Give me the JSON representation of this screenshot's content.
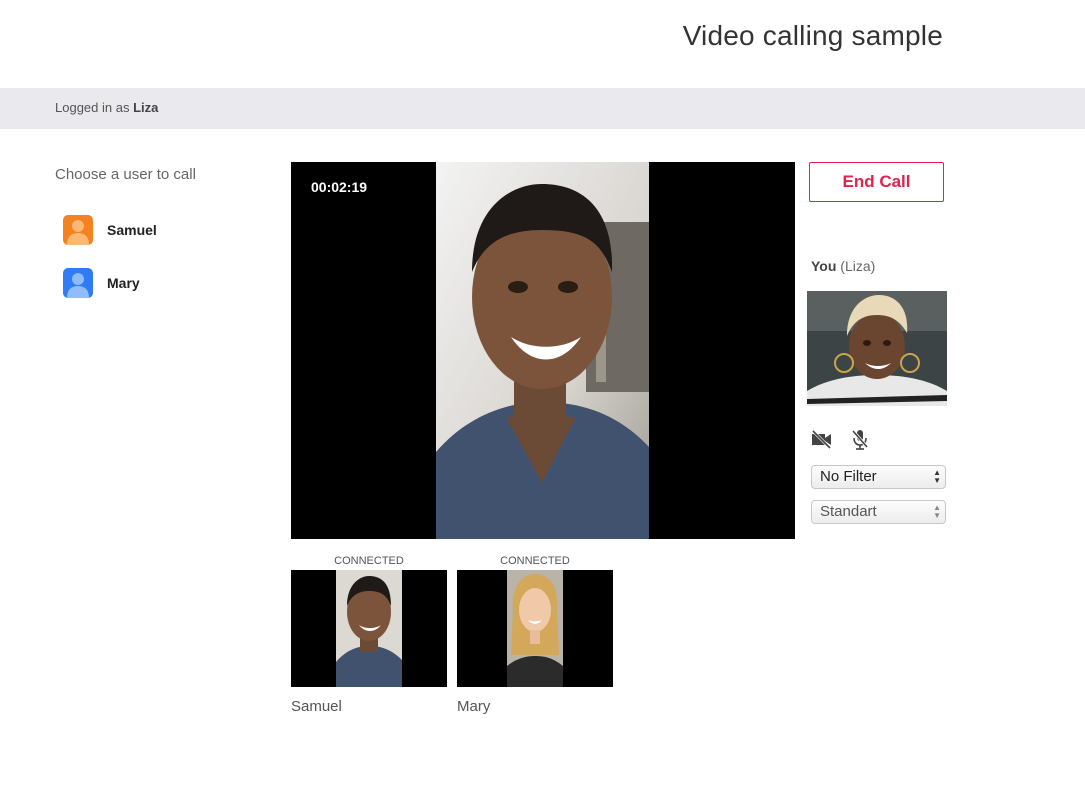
{
  "header": {
    "title": "Video calling sample"
  },
  "status_bar": {
    "prefix": "Logged in as",
    "username": "Liza"
  },
  "sidebar": {
    "heading": "Choose a user to call",
    "users": [
      {
        "name": "Samuel",
        "avatar_color": "#f58220"
      },
      {
        "name": "Mary",
        "avatar_color": "#2f7cf6"
      }
    ]
  },
  "call": {
    "timer": "00:02:19",
    "end_call_label": "End Call",
    "accent_color": "#e0224d"
  },
  "self_view": {
    "you_label": "You",
    "name_label": "(Liza)"
  },
  "controls": {
    "camera_icon": "camera-off-icon",
    "mic_icon": "mic-off-icon",
    "filter_selected": "No Filter",
    "quality_selected": "Standart"
  },
  "participants": [
    {
      "status": "CONNECTED",
      "name": "Samuel"
    },
    {
      "status": "CONNECTED",
      "name": "Mary"
    }
  ]
}
